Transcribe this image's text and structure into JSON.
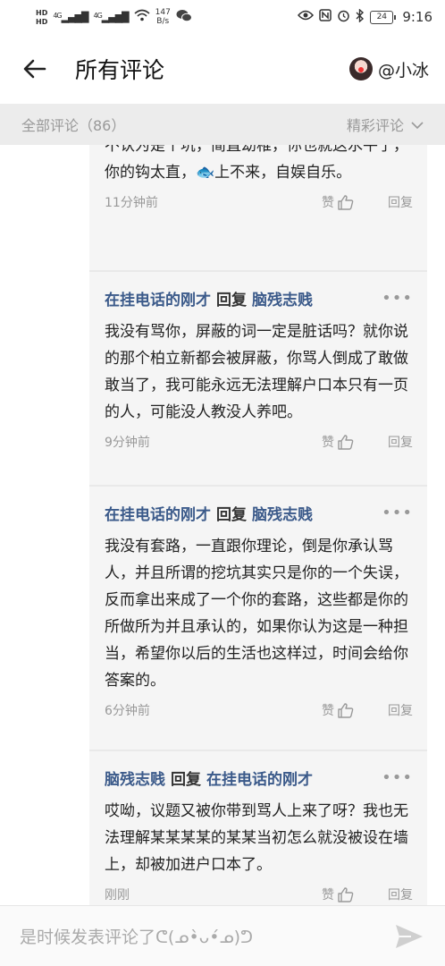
{
  "status_bar": {
    "hd1": "HD",
    "hd2": "HD",
    "net1": "4G",
    "net2": "4G",
    "speed_value": "147",
    "speed_unit": "B/s",
    "battery": "24",
    "time": "9:16"
  },
  "header": {
    "title": "所有评论",
    "username": "@小冰"
  },
  "filter": {
    "all_label": "全部评论（86）",
    "sort_label": "精彩评论"
  },
  "comments": [
    {
      "body": "不认为是个坑，简直幼稚，你也就这水平了，你的钩太直，🐟上不来，自娱自乐。",
      "time": "11分钟前",
      "like_label": "赞",
      "reply_label": "回复"
    },
    {
      "author": "在挂电话的刚才",
      "reply_word": "回复",
      "target": "脑残志贱",
      "body": "我没有骂你，屏蔽的词一定是脏话吗？就你说的那个柏立新都会被屏蔽，你骂人倒成了敢做敢当了，我可能永远无法理解户口本只有一页的人，可能没人教没人养吧。",
      "time": "9分钟前",
      "like_label": "赞",
      "reply_label": "回复"
    },
    {
      "author": "在挂电话的刚才",
      "reply_word": "回复",
      "target": "脑残志贱",
      "body": "我没有套路，一直跟你理论，倒是你承认骂人，并且所谓的挖坑其实只是你的一个失误，反而拿出来成了一个你的套路，这些都是你的所做所为并且承认的，如果你认为这是一种担当，希望你以后的生活也这样过，时间会给你答案的。",
      "time": "6分钟前",
      "like_label": "赞",
      "reply_label": "回复"
    },
    {
      "author": "脑残志贱",
      "reply_word": "回复",
      "target": "在挂电话的刚才",
      "body": "哎呦，议题又被你带到骂人上来了呀？我也无法理解某某某某的某某当初怎么就没被设在墙上，却被加进户口本了。",
      "time": "刚刚",
      "like_label": "赞",
      "reply_label": "回复"
    }
  ],
  "input": {
    "placeholder": "是时候发表评论了ᕦ(ᓄ•̀ᴗ•́ᓄ)ᕤ"
  }
}
